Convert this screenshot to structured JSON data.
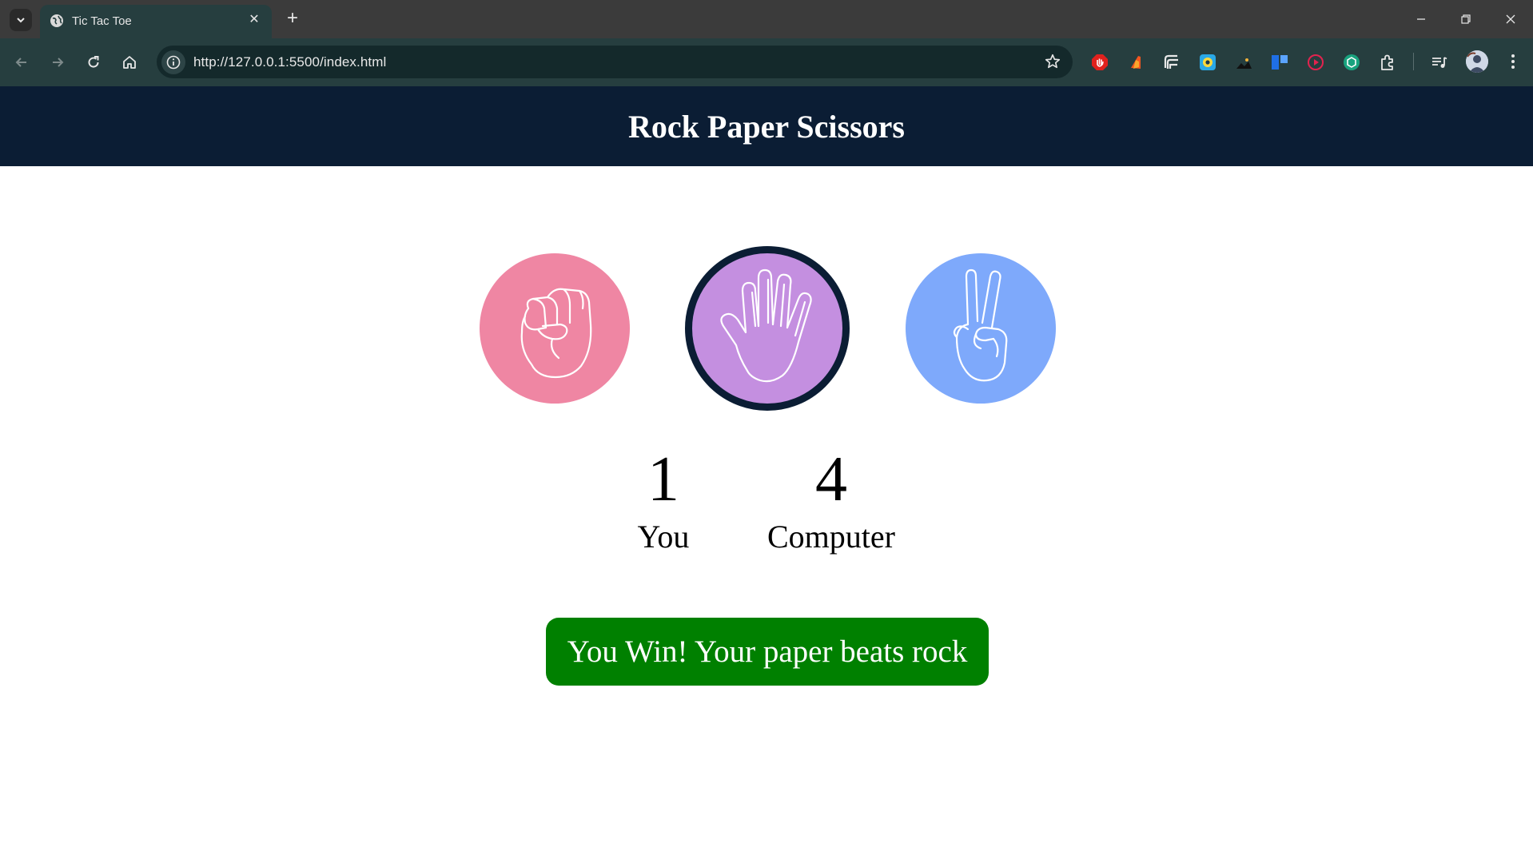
{
  "browser": {
    "tab_title": "Tic Tac Toe",
    "url": "http://127.0.0.1:5500/index.html"
  },
  "header": {
    "title": "Rock Paper Scissors"
  },
  "choices": [
    {
      "name": "rock",
      "color": "#ef86a3",
      "icon": "fist-icon",
      "selected": false
    },
    {
      "name": "paper",
      "color": "#c48fe0",
      "icon": "open-hand-icon",
      "selected": true
    },
    {
      "name": "scissors",
      "color": "#7ea9fb",
      "icon": "peace-hand-icon",
      "selected": false
    }
  ],
  "score": {
    "user": {
      "value": "1",
      "label": "You"
    },
    "computer": {
      "value": "4",
      "label": "Computer"
    }
  },
  "message": {
    "text": "You Win! Your paper beats rock",
    "color": "#008000"
  },
  "colors": {
    "header_bg": "#0b1d34",
    "selected_border": "#0b1d34"
  }
}
